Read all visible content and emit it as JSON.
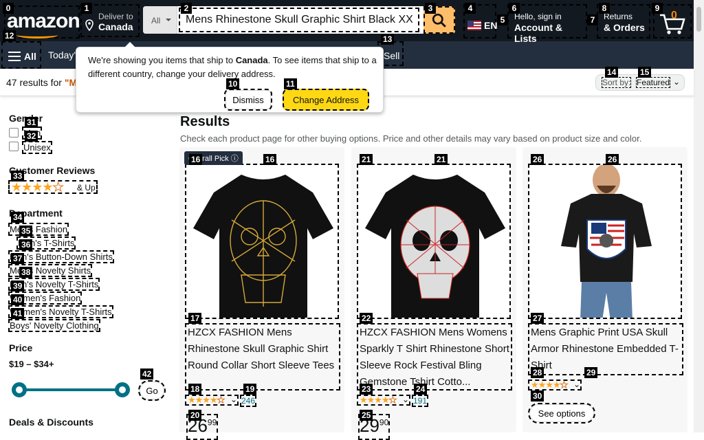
{
  "header": {
    "logo_text": "amazon",
    "deliver_to_label": "Deliver to",
    "deliver_to_location": "Canada",
    "search_category": "All",
    "search_value": "Mens Rhinestone Skull Graphic Shirt Black XX-Large",
    "language": "EN",
    "account_line1": "Hello, sign in",
    "account_line2": "Account & Lists",
    "returns_line1": "Returns",
    "returns_line2": "& Orders",
    "cart_count": "0"
  },
  "subnav": {
    "all_label": "All",
    "todays_deals": "Today's",
    "sell": "Sell"
  },
  "popover": {
    "message_pre": "We're showing you items that ship to ",
    "message_bold": "Canada",
    "message_post": ". To see items that ship to a different country, change your delivery address.",
    "dismiss_label": "Dismiss",
    "change_label": "Change Address"
  },
  "results_bar": {
    "count_text": "47 results for ",
    "query_text": "\"M"
  },
  "sort": {
    "label": "Sort by:",
    "value": "Featured"
  },
  "sidebar": {
    "gender_heading": "Gender",
    "gender_options": [
      "Men",
      "Unisex"
    ],
    "reviews_heading": "Customer Reviews",
    "reviews_filter": "& Up",
    "department_heading": "Department",
    "departments": [
      "Men's Fashion",
      "Men's T-Shirts",
      "Men's Button-Down Shirts",
      "Men's Novelty Shirts",
      "Men's Novelty T-Shirts",
      "Women's Fashion",
      "Women's Novelty T-Shirts",
      "Boys' Novelty Clothing"
    ],
    "price_heading": "Price",
    "price_range": "$19 – $34+",
    "go_label": "Go",
    "deals_heading": "Deals & Discounts"
  },
  "main": {
    "heading": "Results",
    "subheading": "Check each product page for other buying options. Price and other details may vary based on product size and color."
  },
  "products": [
    {
      "badge": "Overall Pick",
      "title": "HZCX FASHION Mens Rhinestone Skull Graphic Shirt Round Collar Short Sleeve Tees",
      "rating_count": "246",
      "price_whole": "26",
      "price_fraction": "99"
    },
    {
      "title": "HZCX FASHION Mens Womens Sparkly T Shirt Rhinestone Short Sleeve Rock Festival Bling Gemstone Tshirt Cotto...",
      "rating_count": "191",
      "price_whole": "29",
      "price_fraction": "90"
    },
    {
      "title": "Mens Graphic Print USA Skull Armor Rhinestone Embedded T-Shirt",
      "see_options": "See options"
    }
  ],
  "colors": {
    "nav_dark": "#131921",
    "nav_sub": "#232f3e",
    "search_button": "#febd69",
    "primary_button": "#ffd814",
    "link_teal": "#007185",
    "star_orange": "#ffa41c",
    "price_range_slider": "#007185"
  }
}
